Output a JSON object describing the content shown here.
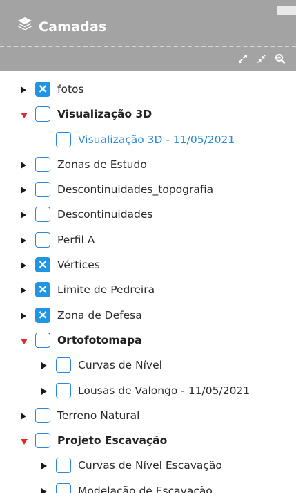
{
  "panel": {
    "title": "Camadas",
    "header_icon": "layers-icon",
    "tools": [
      {
        "name": "expand-all-icon"
      },
      {
        "name": "collapse-all-icon"
      },
      {
        "name": "zoom-icon"
      }
    ]
  },
  "colors": {
    "header_bg": "#a3a3a3",
    "checkbox_accent": "#1f95e3",
    "expanded_arrow": "#d92c2c",
    "link_text": "#2a88d6"
  },
  "layers": [
    {
      "label": "fotos",
      "checked": true,
      "arrow": "right",
      "level": 0,
      "style": "normal"
    },
    {
      "label": "Visualização 3D",
      "checked": false,
      "arrow": "down",
      "level": 0,
      "style": "bold"
    },
    {
      "label": "Visualização 3D - 11/05/2021",
      "checked": false,
      "arrow": "none",
      "level": 1,
      "style": "link"
    },
    {
      "label": "Zonas de Estudo",
      "checked": false,
      "arrow": "right",
      "level": 0,
      "style": "normal"
    },
    {
      "label": "Descontinuidades_topografia",
      "checked": false,
      "arrow": "right",
      "level": 0,
      "style": "normal"
    },
    {
      "label": "Descontinuidades",
      "checked": false,
      "arrow": "right",
      "level": 0,
      "style": "normal"
    },
    {
      "label": "Perfil A",
      "checked": false,
      "arrow": "right",
      "level": 0,
      "style": "normal"
    },
    {
      "label": "Vértices",
      "checked": true,
      "arrow": "right",
      "level": 0,
      "style": "normal"
    },
    {
      "label": "Limite de Pedreira",
      "checked": true,
      "arrow": "right",
      "level": 0,
      "style": "normal"
    },
    {
      "label": "Zona de Defesa",
      "checked": true,
      "arrow": "right",
      "level": 0,
      "style": "normal"
    },
    {
      "label": "Ortofotomapa",
      "checked": false,
      "arrow": "down",
      "level": 0,
      "style": "bold"
    },
    {
      "label": "Curvas de Nível",
      "checked": false,
      "arrow": "right",
      "level": 1,
      "style": "normal"
    },
    {
      "label": "Lousas de Valongo - 11/05/2021",
      "checked": false,
      "arrow": "right",
      "level": 1,
      "style": "normal"
    },
    {
      "label": "Terreno Natural",
      "checked": false,
      "arrow": "right",
      "level": 0,
      "style": "normal"
    },
    {
      "label": "Projeto Escavação",
      "checked": false,
      "arrow": "down",
      "level": 0,
      "style": "bold"
    },
    {
      "label": "Curvas de Nível Escavação",
      "checked": false,
      "arrow": "right",
      "level": 1,
      "style": "normal"
    },
    {
      "label": "Modelação de Escavação",
      "checked": false,
      "arrow": "right",
      "level": 1,
      "style": "normal"
    }
  ]
}
